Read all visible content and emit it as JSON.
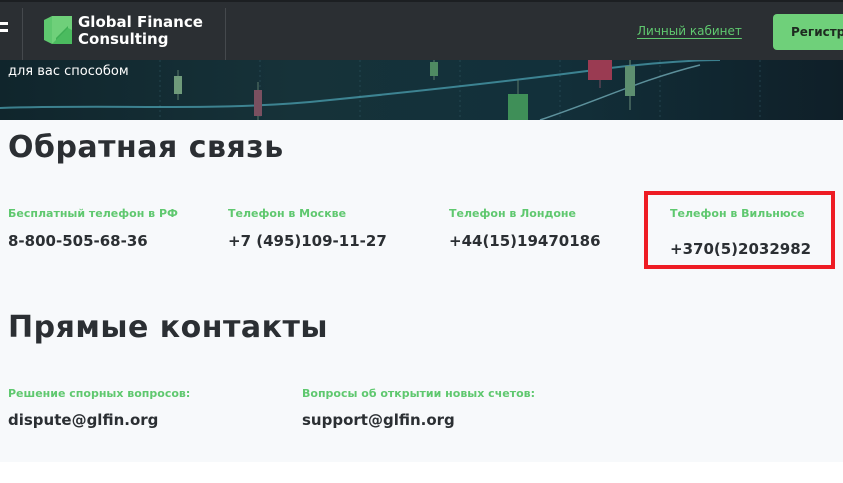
{
  "header": {
    "brand_line1": "Global Finance",
    "brand_line2": "Consulting",
    "cabinet_link": "Личный кабинет",
    "register_button": "Регистр"
  },
  "hero": {
    "text": "для вас способом"
  },
  "feedback": {
    "title": "Обратная связь",
    "phones": [
      {
        "label": "Бесплатный телефон в РФ",
        "value": "8-800-505-68-36"
      },
      {
        "label": "Телефон в Москве",
        "value": "+7 (495)109-11-27"
      },
      {
        "label": "Телефон в Лондоне",
        "value": "+44(15)19470186"
      },
      {
        "label": "Телефон в Вильнюсе",
        "value": "+370(5)2032982"
      }
    ]
  },
  "direct_contacts": {
    "title": "Прямые контакты",
    "items": [
      {
        "label": "Решение спорных вопросов:",
        "value": "dispute@glfin.org"
      },
      {
        "label": "Вопросы об открытии новых счетов:",
        "value": "support@glfin.org"
      }
    ]
  },
  "colors": {
    "accent": "#5fc86f",
    "header_bg": "#2b2f33",
    "highlight": "#ee1c24"
  }
}
